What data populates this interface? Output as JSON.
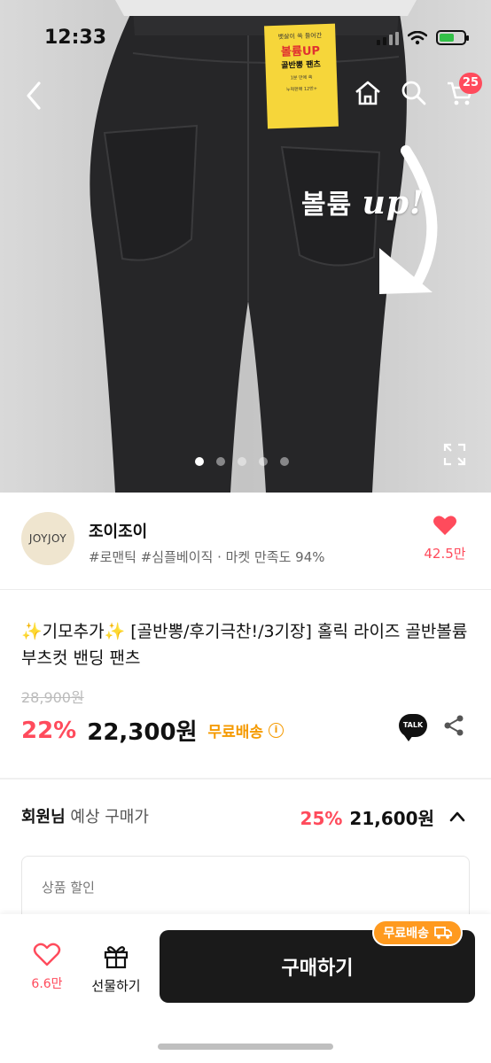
{
  "status": {
    "time": "12:33"
  },
  "header": {
    "cart_count": "25"
  },
  "hero": {
    "tag_lines": [
      "뱃살이 쏙 들어간",
      "볼륨UP",
      "골반뽕 팬츠",
      "1분 만에 쏙",
      "누적판매 12만+"
    ],
    "overlay_text": "볼륨",
    "overlay_emphasis": "up!",
    "page_count": 5,
    "active_page": 0
  },
  "shop": {
    "logo_text": "JOYJOY",
    "name": "조이조이",
    "tags": "#로맨틱 #심플베이직 · 마켓 만족도 94%",
    "like_count": "42.5만"
  },
  "product": {
    "title": "✨기모추가✨ [골반뽕/후기극찬!/3기장] 홀릭 라이즈 골반볼륨 부츠컷 밴딩 팬츠",
    "original_price": "28,900원",
    "discount": "22%",
    "price": "22,300원",
    "free_shipping": "무료배송",
    "talk_label": "TALK"
  },
  "member": {
    "label_bold": "회원님",
    "label_rest": " 예상 구매가",
    "discount": "25%",
    "price": "21,600원"
  },
  "discount_box": {
    "label": "상품 할인"
  },
  "bottom": {
    "wish_count": "6.6만",
    "gift_label": "선물하기",
    "buy_label": "구매하기",
    "ship_chip": "무료배송"
  },
  "colors": {
    "accent": "#ff4b5c",
    "shipping": "#f59a00",
    "buy_button": "#1a1a1a"
  }
}
